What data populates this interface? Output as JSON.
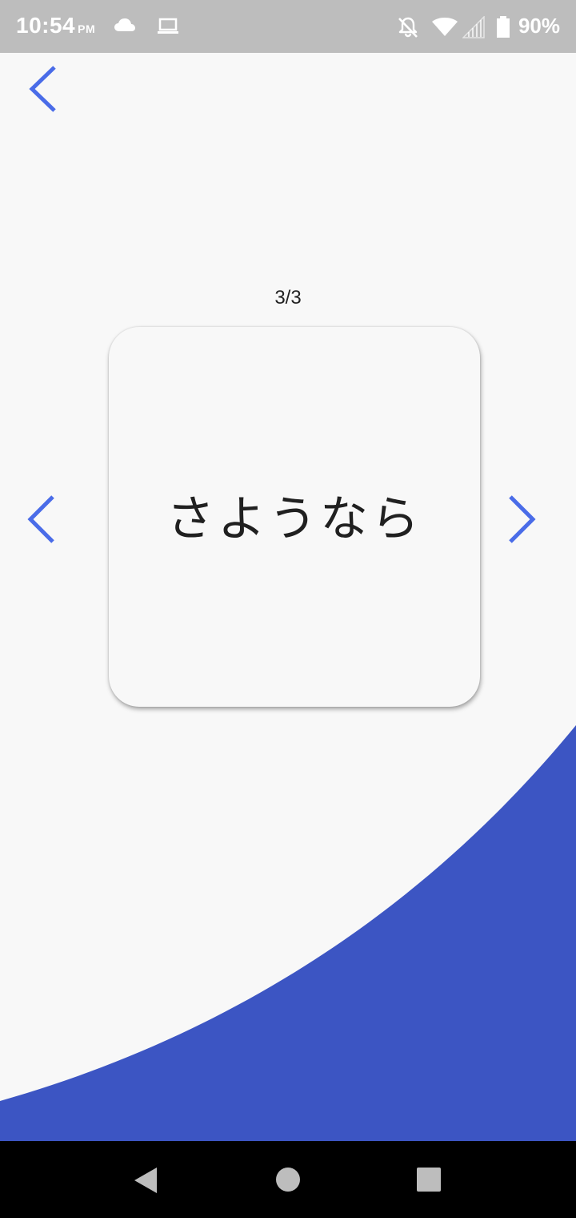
{
  "status_bar": {
    "time": "10:54",
    "ampm": "PM",
    "battery": "90%",
    "icons": [
      "cloud-icon",
      "laptop-icon",
      "notifications-off-icon",
      "wifi-icon",
      "signal-icon",
      "battery-icon"
    ]
  },
  "header": {
    "back_icon": "chevron-left-icon"
  },
  "flashcard": {
    "counter": "3/3",
    "word": "さようなら",
    "prev_icon": "chevron-left-icon",
    "next_icon": "chevron-right-icon"
  },
  "colors": {
    "accent": "#4a6ce8",
    "decor_blue": "#3c55c3",
    "background": "#f8f8f8",
    "status_bar": "#bdbdbd"
  },
  "system_nav": {
    "icons": [
      "back-triangle-icon",
      "home-circle-icon",
      "recents-square-icon"
    ]
  }
}
